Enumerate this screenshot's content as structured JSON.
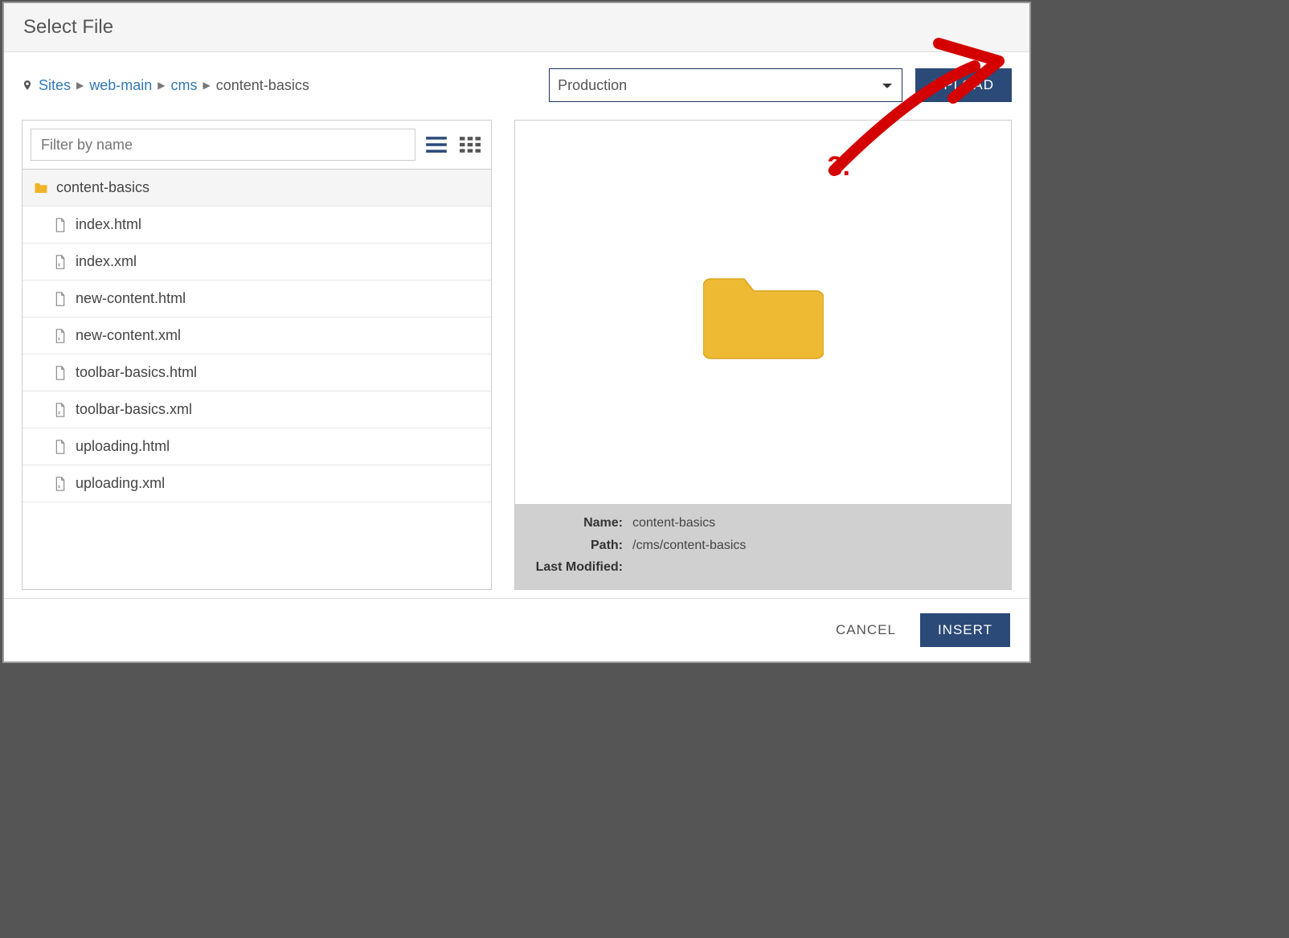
{
  "dialog": {
    "title": "Select File"
  },
  "breadcrumb": {
    "items": [
      {
        "label": "Sites",
        "link": true
      },
      {
        "label": "web-main",
        "link": true
      },
      {
        "label": "cms",
        "link": true
      },
      {
        "label": "content-basics",
        "link": false
      }
    ]
  },
  "environment": {
    "selected": "Production"
  },
  "buttons": {
    "upload": "UPLOAD",
    "cancel": "CANCEL",
    "insert": "INSERT"
  },
  "filter": {
    "placeholder": "Filter by name"
  },
  "files": {
    "folder": "content-basics",
    "items": [
      {
        "name": "index.html",
        "type": "html"
      },
      {
        "name": "index.xml",
        "type": "xml"
      },
      {
        "name": "new-content.html",
        "type": "html"
      },
      {
        "name": "new-content.xml",
        "type": "xml"
      },
      {
        "name": "toolbar-basics.html",
        "type": "html"
      },
      {
        "name": "toolbar-basics.xml",
        "type": "xml"
      },
      {
        "name": "uploading.html",
        "type": "html"
      },
      {
        "name": "uploading.xml",
        "type": "xml"
      }
    ]
  },
  "preview": {
    "meta": {
      "name_label": "Name:",
      "name_value": "content-basics",
      "path_label": "Path:",
      "path_value": "/cms/content-basics",
      "modified_label": "Last Modified:",
      "modified_value": ""
    }
  },
  "annotation": {
    "label": "3."
  }
}
